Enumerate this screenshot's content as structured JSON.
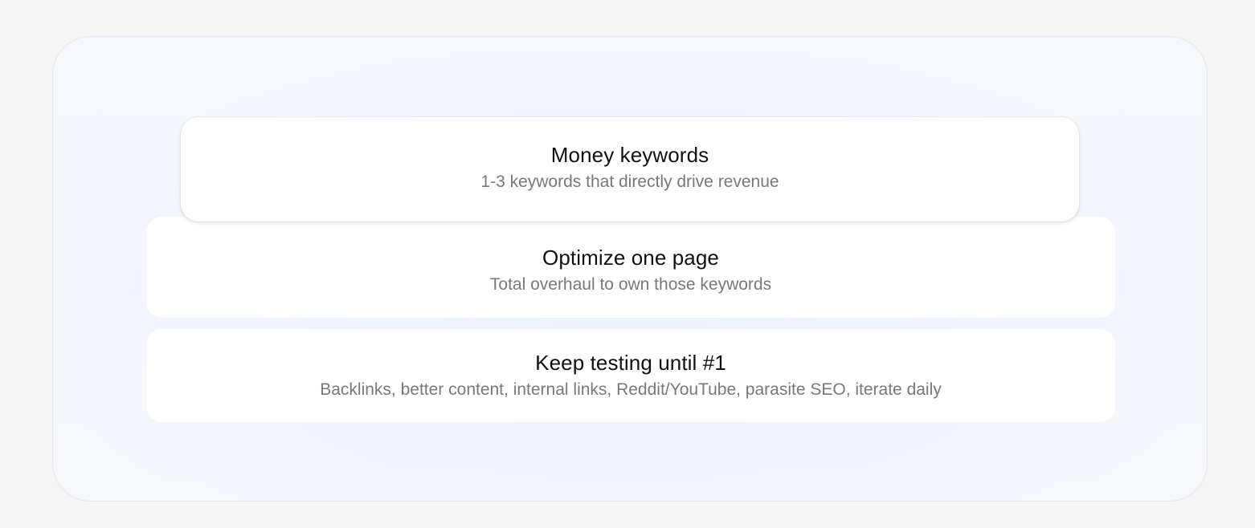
{
  "steps": [
    {
      "title": "Money keywords",
      "description": "1-3 keywords that directly drive revenue"
    },
    {
      "title": "Optimize one page",
      "description": "Total overhaul to own those keywords"
    },
    {
      "title": "Keep testing until #1",
      "description": "Backlinks, better content, internal links, Reddit/YouTube, parasite SEO, iterate daily"
    }
  ],
  "colors": {
    "page_background": "#f6f6f6",
    "frame_background": "#f4f7fc",
    "card_background": "#ffffff",
    "title_text": "#111111",
    "description_text": "#76787c"
  }
}
